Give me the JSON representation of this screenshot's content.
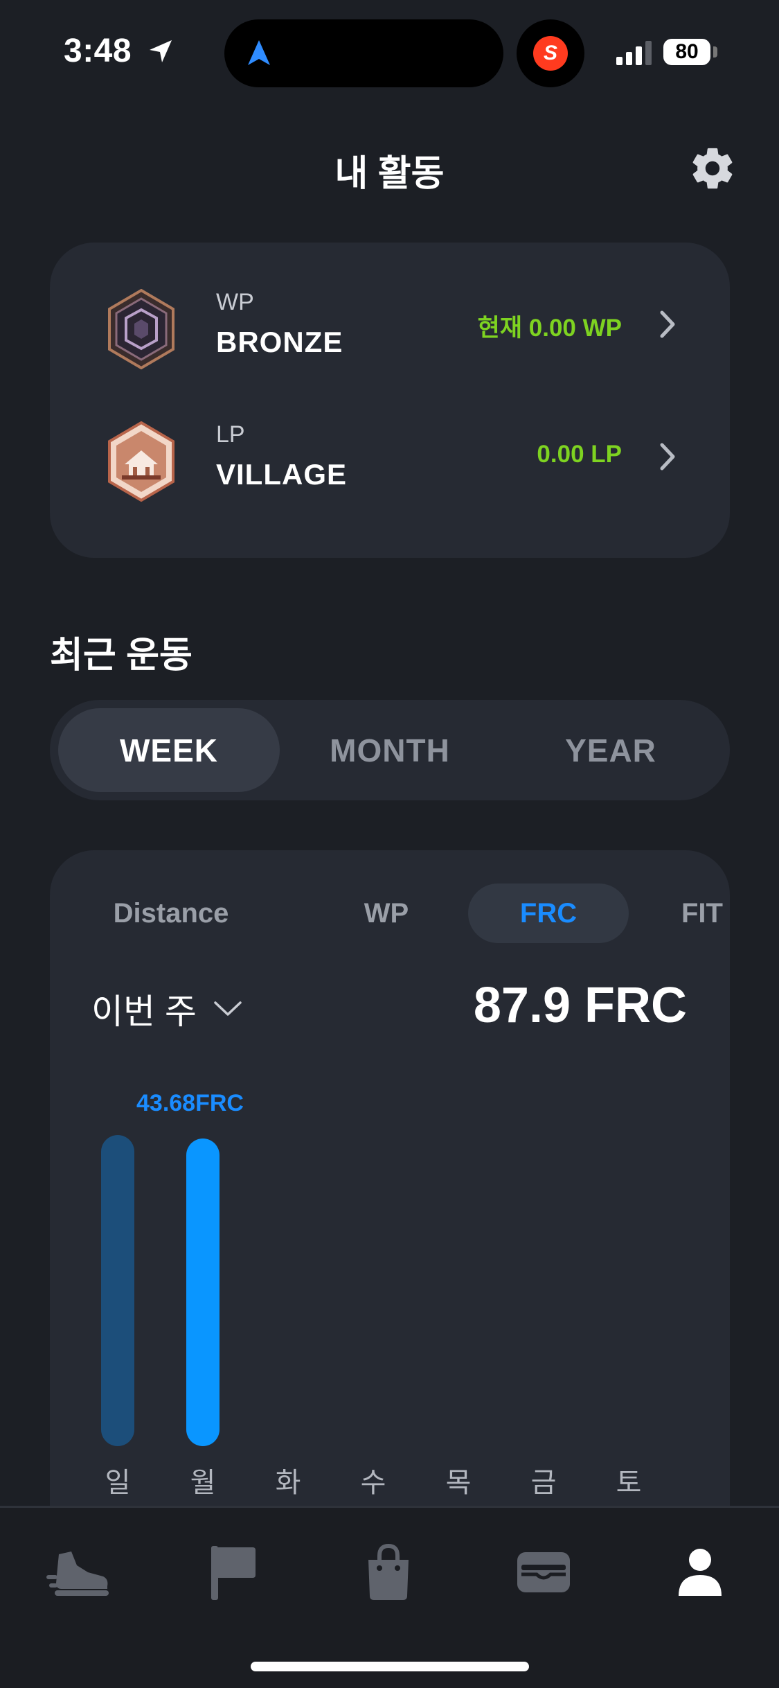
{
  "status_bar": {
    "time": "3:48",
    "battery": "80",
    "app_icon_letter": "S",
    "icons": [
      "location-arrow-icon",
      "navigation-icon",
      "signal-icon",
      "battery-icon"
    ]
  },
  "header": {
    "title": "내 활동",
    "settings_icon": "gear-icon"
  },
  "ranks": [
    {
      "type": "WP",
      "name": "BRONZE",
      "value": "현재 0.00 WP",
      "badge": "bronze-hexagon-badge"
    },
    {
      "type": "LP",
      "name": "VILLAGE",
      "value": "0.00 LP",
      "badge": "village-house-badge"
    }
  ],
  "recent": {
    "title": "최근 운동",
    "periods": [
      "WEEK",
      "MONTH",
      "YEAR"
    ],
    "active_period": "WEEK",
    "metric_tabs": [
      "Distance",
      "WP",
      "FRC",
      "FIT"
    ],
    "active_metric": "FRC",
    "range_label": "이번 주",
    "total": "87.9 FRC"
  },
  "chart_data": {
    "type": "bar",
    "categories": [
      "일",
      "월",
      "화",
      "수",
      "목",
      "금",
      "토"
    ],
    "values": [
      44.2,
      43.68,
      0,
      0,
      0,
      0,
      0
    ],
    "highlighted_index": 1,
    "highlight_label": "43.68FRC",
    "colors": {
      "normal": "#1c4e7a",
      "highlight": "#0a96ff"
    },
    "ylim": [
      0,
      45.5
    ]
  },
  "tabbar": {
    "items": [
      {
        "name": "tab-run",
        "icon": "sneaker-icon",
        "active": false
      },
      {
        "name": "tab-challenge",
        "icon": "flag-icon",
        "active": false
      },
      {
        "name": "tab-shop",
        "icon": "shopping-bag-icon",
        "active": false
      },
      {
        "name": "tab-wallet",
        "icon": "wallet-icon",
        "active": false
      },
      {
        "name": "tab-profile",
        "icon": "person-icon",
        "active": true
      }
    ]
  }
}
